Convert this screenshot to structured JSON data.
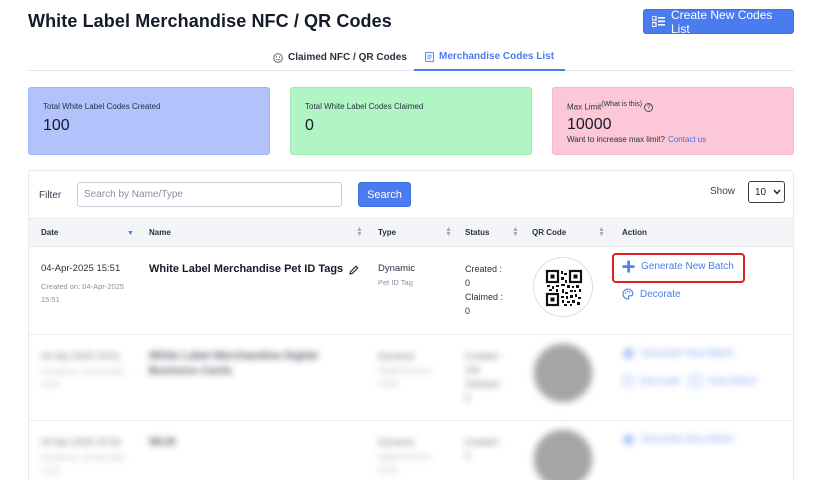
{
  "header": {
    "title": "White Label Merchandise NFC / QR Codes",
    "create_button": "Create New Codes List"
  },
  "tabs": [
    {
      "label": "Claimed NFC / QR Codes",
      "active": false
    },
    {
      "label": "Merchandise Codes List",
      "active": true
    }
  ],
  "cards": {
    "created": {
      "label": "Total White Label Codes Created",
      "value": "100"
    },
    "claimed": {
      "label": "Total White Label Codes Claimed",
      "value": "0"
    },
    "max": {
      "label": "Max Limit",
      "what": "(What is this)",
      "value": "10000",
      "question": "Want to increase max limit?",
      "link": "Contact us"
    }
  },
  "filter": {
    "label": "Filter",
    "placeholder": "Search by Name/Type",
    "search_button": "Search",
    "show_label": "Show",
    "show_value": "10"
  },
  "table": {
    "columns": [
      "Date",
      "Name",
      "Type",
      "Status",
      "QR Code",
      "Action"
    ],
    "rows": [
      {
        "date": "04-Apr-2025 15:51",
        "created_on": "Created on: 04-Apr-2025 15:51",
        "name": "White Label Merchandise Pet ID Tags",
        "type": "Dynamic",
        "subtype": "Pet ID Tag",
        "created_label": "Created :",
        "created_value": "0",
        "claimed_label": "Claimed :",
        "claimed_value": "0",
        "action_generate": "Generate New Batch",
        "action_decorate": "Decorate"
      },
      {
        "date": "04-Apr-2025 15:51",
        "created_on": "Created on: 04-Apr-2025 15:51",
        "name": "White Label Merchandise Digital Business Cards",
        "type": "Dynamic",
        "subtype": "Digital Business Cards",
        "created_label": "Created :",
        "created_value": "100",
        "claimed_label": "Claimed :",
        "claimed_value": "0",
        "action_generate": "Generate New Batch",
        "action_decorate": "Decorate",
        "action_view": "View Batch"
      },
      {
        "date": "04-Apr-2025 15:33",
        "created_on": "Created on: 16-Mar-2025 15:20",
        "name": "WLM",
        "type": "Dynamic",
        "subtype": "Digital Business Cards",
        "created_label": "Created :",
        "created_value": "0",
        "action_generate": "Generate New Batch"
      }
    ]
  },
  "colors": {
    "accent": "#4a7cf0",
    "highlight": "#e02020"
  }
}
